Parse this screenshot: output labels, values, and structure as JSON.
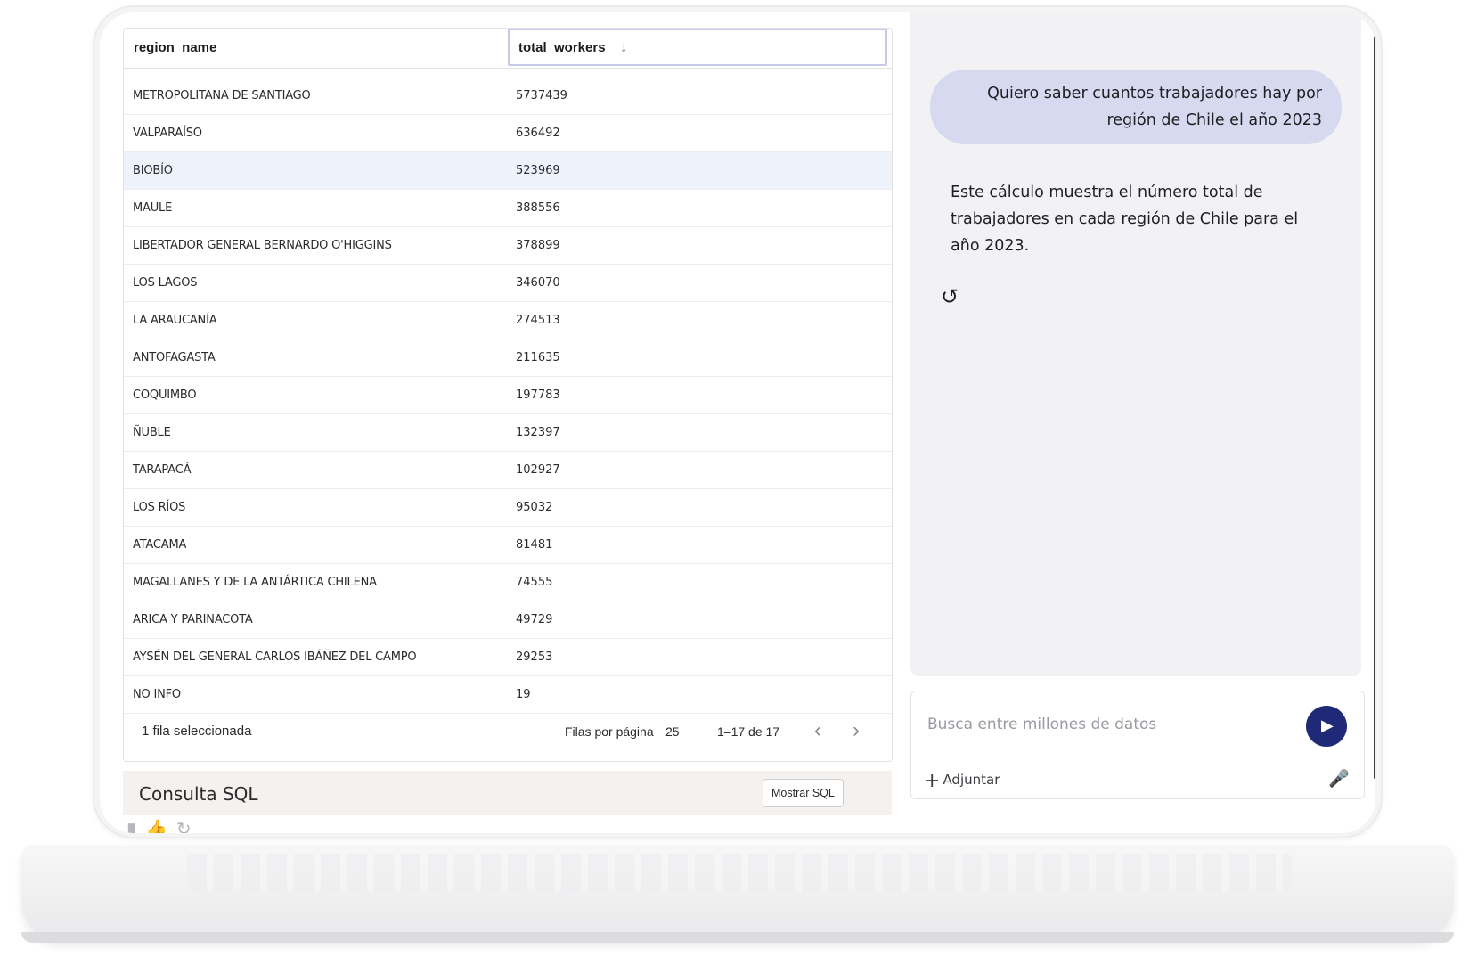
{
  "table": {
    "columns": [
      "region_name",
      "total_workers"
    ],
    "sort_icon": "arrow-down-icon",
    "rows": [
      [
        "METROPOLITANA DE SANTIAGO",
        "5737439"
      ],
      [
        "VALPARAÍSO",
        "636492"
      ],
      [
        "BIOBÍO",
        "523969"
      ],
      [
        "MAULE",
        "388556"
      ],
      [
        "LIBERTADOR GENERAL BERNARDO O'HIGGINS",
        "378899"
      ],
      [
        "LOS LAGOS",
        "346070"
      ],
      [
        "LA ARAUCANÍA",
        "274513"
      ],
      [
        "ANTOFAGASTA",
        "211635"
      ],
      [
        "COQUIMBO",
        "197783"
      ],
      [
        "ÑUBLE",
        "132397"
      ],
      [
        "TARAPACÁ",
        "102927"
      ],
      [
        "LOS RÍOS",
        "95032"
      ],
      [
        "ATACAMA",
        "81481"
      ],
      [
        "MAGALLANES Y DE LA ANTÁRTICA CHILENA",
        "74555"
      ],
      [
        "ARICA Y PARINACOTA",
        "49729"
      ],
      [
        "AYSÉN DEL GENERAL CARLOS IBÁÑEZ DEL CAMPO",
        "29253"
      ],
      [
        "NO INFO",
        "19"
      ]
    ],
    "selected_row": "BIOBÍO",
    "footer": {
      "selected_text": "1 fila seleccionada",
      "rows_per_page_label": "Filas por página",
      "rows_per_page_value": "25",
      "range_text": "1–17 de 17",
      "prev_icon": "chevron-left-icon",
      "next_icon": "chevron-right-icon"
    }
  },
  "sql": {
    "title": "Consulta SQL",
    "button": "Mostrar SQL"
  },
  "feedback_icons": [
    "thumbs-down-icon",
    "thumbs-up-icon",
    "refresh-icon"
  ],
  "chat": {
    "user_message_line1": "Quiero saber cuantos trabajadores hay por",
    "user_message_line2": "región de Chile el año 2023",
    "assistant_message": "Este cálculo muestra el número total de trabajadores en cada región de Chile para el año 2023.",
    "regenerate_icon": "regenerate-icon",
    "input_placeholder": "Busca entre millones de datos",
    "attach_label": "Adjuntar",
    "send_icon": "play-icon",
    "mic_icon": "microphone-icon",
    "colors": {
      "user_bubble": "#d7d9f0",
      "send_button": "#1e2a78",
      "selected_row": "#edf2fb",
      "panel_bg": "#f2f2f5"
    }
  }
}
